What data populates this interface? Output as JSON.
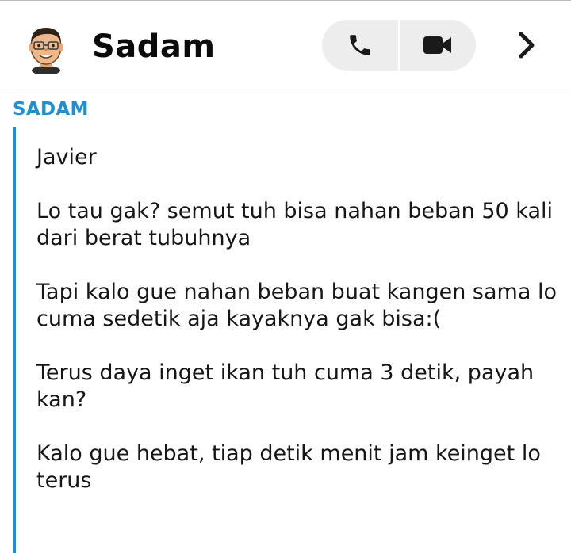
{
  "header": {
    "contact_name": "Sadam",
    "avatar_icon": "bitmoji-avatar-icon",
    "phone_icon": "phone-icon",
    "video_icon": "video-camera-icon",
    "more_icon": "chevron-right-icon"
  },
  "chat": {
    "sender_label": "SADAM",
    "accent_color": "#1d8fd6",
    "message_lines": [
      "Javier",
      "Lo tau gak? semut tuh bisa nahan beban 50 kali dari berat tubuhnya",
      "Tapi kalo gue nahan beban buat kangen sama lo cuma sedetik aja kayaknya gak bisa:(",
      "Terus daya inget ikan tuh cuma 3 detik, payah kan?",
      "Kalo gue hebat, tiap detik menit jam keinget lo terus"
    ]
  }
}
